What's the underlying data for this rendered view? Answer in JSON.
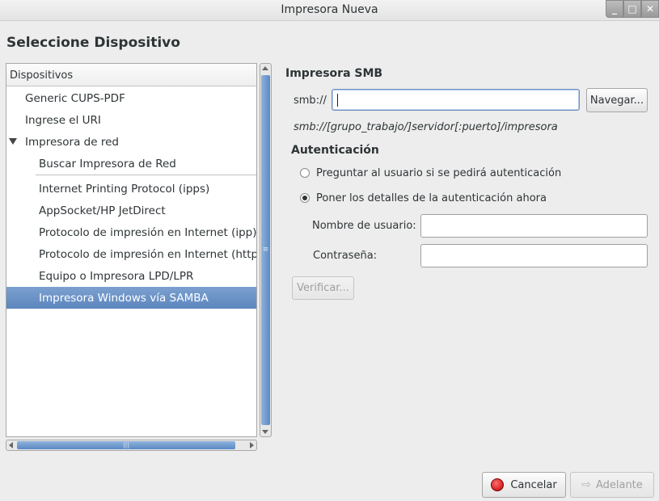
{
  "window": {
    "title": "Impresora Nueva",
    "controls": {
      "minimize": "_",
      "maximize": "□",
      "close": "✕"
    }
  },
  "heading": "Seleccione Dispositivo",
  "tree": {
    "header": "Dispositivos",
    "items": [
      {
        "label": "Generic CUPS-PDF"
      },
      {
        "label": "Ingrese el URI"
      },
      {
        "label": "Impresora de red"
      },
      {
        "label": "Buscar Impresora de Red"
      },
      {
        "label": "Internet Printing Protocol (ipps)"
      },
      {
        "label": "AppSocket/HP JetDirect"
      },
      {
        "label": "Protocolo de impresión en Internet (ipp)"
      },
      {
        "label": "Protocolo de impresión en Internet (https)"
      },
      {
        "label": "Equipo o Impresora LPD/LPR"
      },
      {
        "label": "Impresora Windows vía SAMBA"
      }
    ]
  },
  "smb": {
    "section_title": "Impresora SMB",
    "url_label": "smb://",
    "url_value": "",
    "browse_button": "Navegar...",
    "hint": "smb://[grupo_trabajo/]servidor[:puerto]/impresora"
  },
  "auth": {
    "section_title": "Autenticación",
    "option_ask": "Preguntar al usuario si se pedirá autenticación",
    "option_now": "Poner los detalles de la autenticación ahora",
    "username_label": "Nombre de usuario:",
    "username_value": "",
    "password_label": "Contraseña:",
    "password_value": "",
    "verify_button": "Verificar..."
  },
  "footer": {
    "cancel_button": "Cancelar",
    "forward_button": "Adelante"
  },
  "scrollbar_grip": {
    "vertical": "≡",
    "horizontal": "|||"
  }
}
